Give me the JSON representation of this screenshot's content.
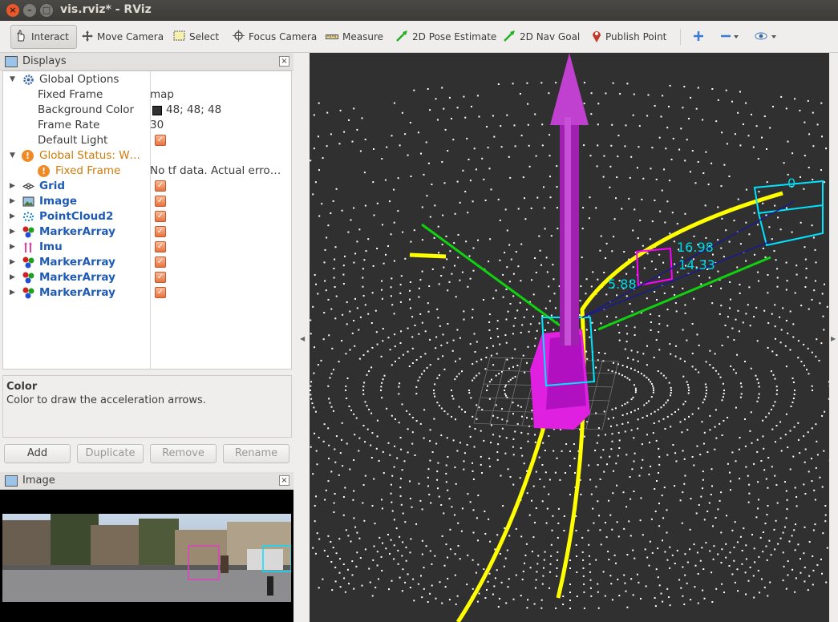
{
  "window": {
    "title": "vis.rviz* - RViz"
  },
  "toolbar": {
    "tools": [
      {
        "label": "Interact"
      },
      {
        "label": "Move Camera"
      },
      {
        "label": "Select"
      },
      {
        "label": "Focus Camera"
      },
      {
        "label": "Measure"
      },
      {
        "label": "2D Pose Estimate"
      },
      {
        "label": "2D Nav Goal"
      },
      {
        "label": "Publish Point"
      }
    ]
  },
  "displays": {
    "title": "Displays",
    "global_options": {
      "label": "Global Options",
      "fixed_frame_label": "Fixed Frame",
      "fixed_frame_value": "map",
      "background_color_label": "Background Color",
      "background_color_value": "48; 48; 48",
      "background_color_hex": "#303030",
      "frame_rate_label": "Frame Rate",
      "frame_rate_value": "30",
      "default_light_label": "Default Light"
    },
    "global_status": {
      "label": "Global Status: W…",
      "fixed_frame_label": "Fixed Frame",
      "fixed_frame_value": "No tf data.  Actual erro…"
    },
    "items": [
      {
        "label": "Grid",
        "icon": "grid-icon"
      },
      {
        "label": "Image",
        "icon": "image-icon"
      },
      {
        "label": "PointCloud2",
        "icon": "pointcloud-icon"
      },
      {
        "label": "MarkerArray",
        "icon": "marker-array-icon"
      },
      {
        "label": "Imu",
        "icon": "imu-icon"
      },
      {
        "label": "MarkerArray",
        "icon": "marker-array-icon"
      },
      {
        "label": "MarkerArray",
        "icon": "marker-array-icon"
      },
      {
        "label": "MarkerArray",
        "icon": "marker-array-icon"
      }
    ],
    "description": {
      "title": "Color",
      "text": "Color to draw the acceleration arrows."
    },
    "buttons": {
      "add": "Add",
      "duplicate": "Duplicate",
      "remove": "Remove",
      "rename": "Rename"
    }
  },
  "image_panel": {
    "title": "Image"
  },
  "view3d": {
    "labels": [
      "0",
      "16.98",
      "14.33",
      "5.88"
    ],
    "colors": {
      "arrow": "#a020b0",
      "path": "#ffff00",
      "box": "#00e5ff",
      "axis": "#00c000"
    }
  }
}
